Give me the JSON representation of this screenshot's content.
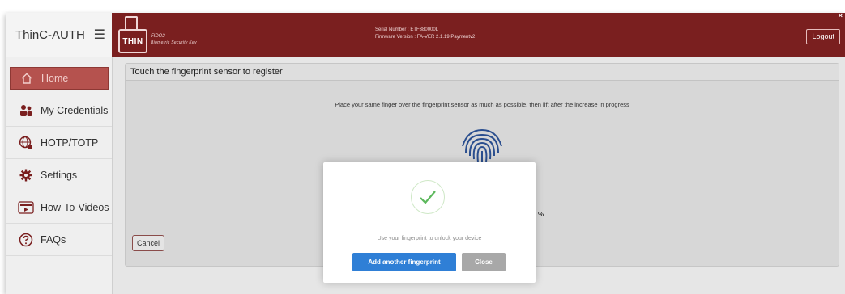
{
  "app": {
    "name": "ThinC-AUTH"
  },
  "brand": {
    "logo_text": "THIN",
    "line1": "FIDO2",
    "line2": "Biometric Security Key"
  },
  "header": {
    "serial_line": "Serial Number    : ETF380000L",
    "firmware_line": "Firmware Version : FA-VER 2.1.19 Paymentv2",
    "logout_label": "Logout",
    "close_glyph": "×"
  },
  "sidebar": {
    "items": [
      {
        "label": "Home",
        "icon": "home-icon",
        "active": true
      },
      {
        "label": "My Credentials",
        "icon": "users-icon"
      },
      {
        "label": "HOTP/TOTP",
        "icon": "globe-icon"
      },
      {
        "label": "Settings",
        "icon": "gear-icon"
      },
      {
        "label": "How-To-Videos",
        "icon": "video-icon"
      },
      {
        "label": "FAQs",
        "icon": "question-icon"
      }
    ]
  },
  "panel": {
    "title": "Touch the fingerprint sensor to register",
    "instruction": "Place your same finger over the fingerprint sensor as much as possible, then lift after the increase in progress",
    "percent_text": "%",
    "cancel_label": "Cancel"
  },
  "modal": {
    "message": "Use your fingerprint to unlock your device",
    "add_label": "Add another fingerprint",
    "close_label": "Close"
  },
  "colors": {
    "header_bg": "#7a1f1f",
    "active_nav": "#b5524e",
    "primary_button": "#2f7fd6",
    "secondary_button": "#a8a8a8",
    "check_green": "#5cb85c"
  }
}
